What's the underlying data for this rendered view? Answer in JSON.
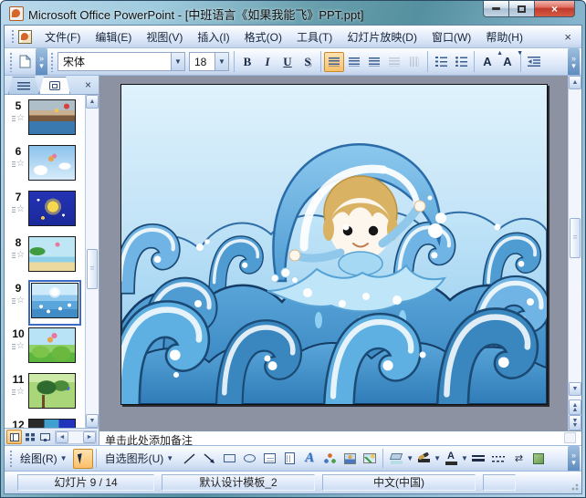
{
  "window": {
    "title": "Microsoft Office PowerPoint - [中班语言《如果我能飞》PPT.ppt]",
    "close_glyph": "×"
  },
  "menu_bar": {
    "items": [
      {
        "label": "文件(F)"
      },
      {
        "label": "编辑(E)"
      },
      {
        "label": "视图(V)"
      },
      {
        "label": "插入(I)"
      },
      {
        "label": "格式(O)"
      },
      {
        "label": "工具(T)"
      },
      {
        "label": "幻灯片放映(D)"
      },
      {
        "label": "窗口(W)"
      },
      {
        "label": "帮助(H)"
      }
    ],
    "close_glyph": "×"
  },
  "format_toolbar": {
    "font_name": "宋体",
    "font_size": "18",
    "bold_label": "B",
    "italic_label": "I",
    "underline_label": "U",
    "shadow_label": "S",
    "grow_font_label": "A",
    "shrink_font_label": "A"
  },
  "slides_panel": {
    "selected_number": "9",
    "slides": [
      {
        "number": "5"
      },
      {
        "number": "6"
      },
      {
        "number": "7"
      },
      {
        "number": "8"
      },
      {
        "number": "9"
      },
      {
        "number": "10"
      },
      {
        "number": "11"
      },
      {
        "number": "12"
      }
    ]
  },
  "notes": {
    "placeholder": "单击此处添加备注"
  },
  "drawing_toolbar": {
    "draw_label": "绘图(R)",
    "autoshapes_label": "自选图形(U)",
    "wordart_label": "A",
    "font_color_label": "A"
  },
  "status_bar": {
    "slide_indicator": "幻灯片 9 / 14",
    "design_template": "默认设计模板_2",
    "language": "中文(中国)"
  },
  "colors": {
    "close_button_red": "#c03a2c",
    "selection_blue": "#3b6bc6",
    "toolbar_highlight_orange": "#fbc06a",
    "canvas_gray": "#8c92a2",
    "sky_top": "#dff2fc",
    "sky_bottom": "#9ecff0",
    "wave_dark_blue": "#2f7cb8",
    "wave_mid_blue": "#4f9cd3",
    "wave_light_blue": "#8cc6ec"
  }
}
